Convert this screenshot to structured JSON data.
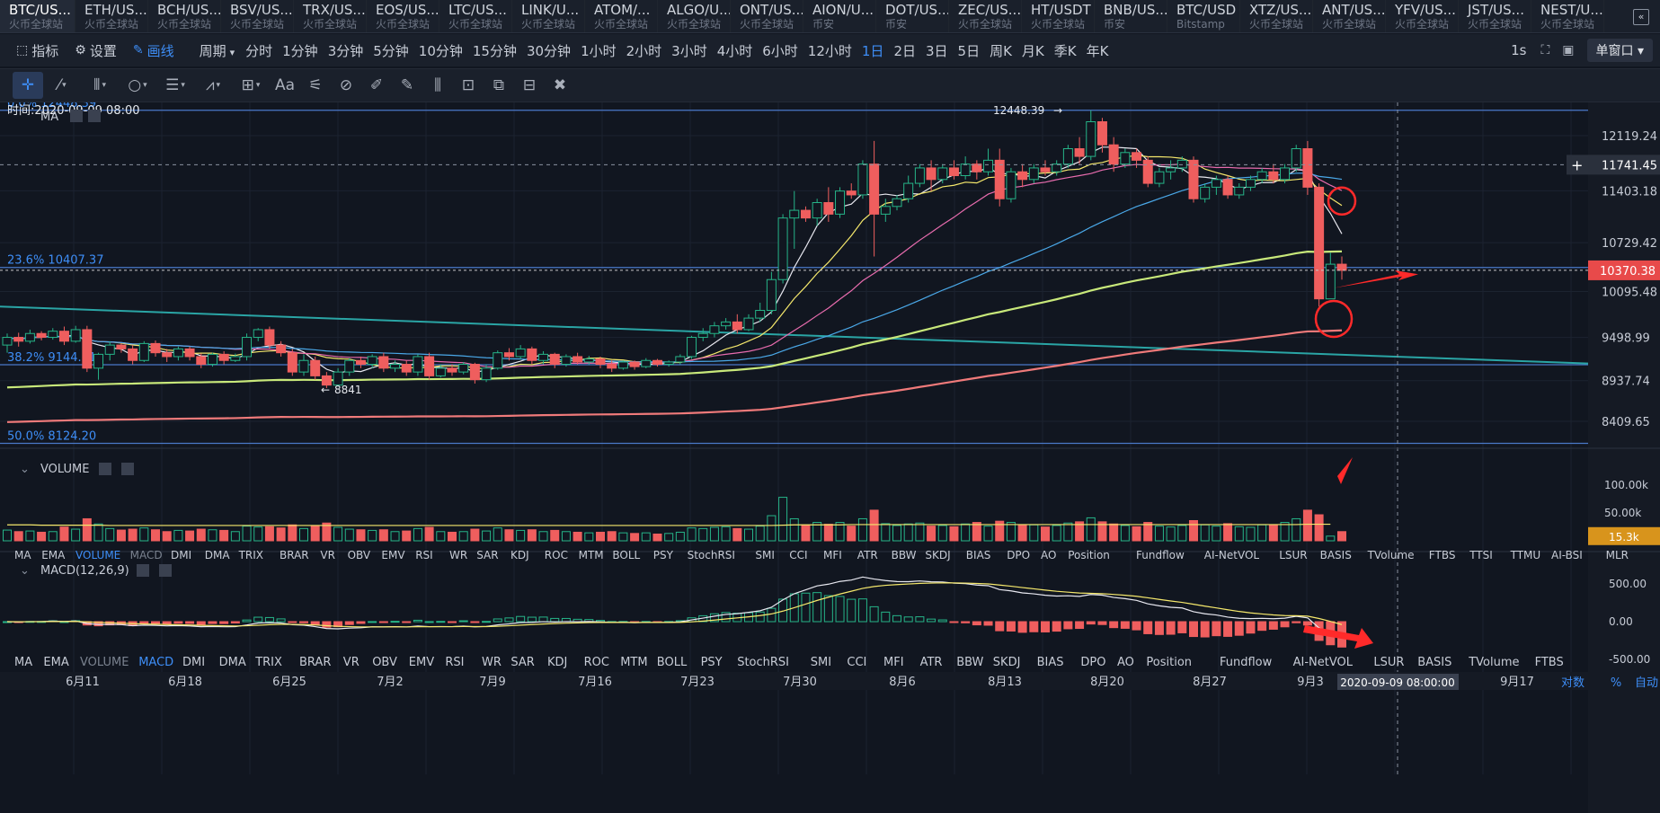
{
  "tabs": [
    {
      "sym": "BTC/US...",
      "ex": "火币全球站",
      "active": true
    },
    {
      "sym": "ETH/US...",
      "ex": "火币全球站"
    },
    {
      "sym": "BCH/US...",
      "ex": "火币全球站"
    },
    {
      "sym": "BSV/US...",
      "ex": "火币全球站"
    },
    {
      "sym": "TRX/US...",
      "ex": "火币全球站"
    },
    {
      "sym": "EOS/US...",
      "ex": "火币全球站"
    },
    {
      "sym": "LTC/US...",
      "ex": "火币全球站"
    },
    {
      "sym": "LINK/U...",
      "ex": "火币全球站"
    },
    {
      "sym": "ATOM/...",
      "ex": "火币全球站"
    },
    {
      "sym": "ALGO/U...",
      "ex": "火币全球站"
    },
    {
      "sym": "ONT/US...",
      "ex": "火币全球站"
    },
    {
      "sym": "AION/U...",
      "ex": "币安"
    },
    {
      "sym": "DOT/US...",
      "ex": "币安"
    },
    {
      "sym": "ZEC/US...",
      "ex": "火币全球站"
    },
    {
      "sym": "HT/USDT",
      "ex": "火币全球站"
    },
    {
      "sym": "BNB/US...",
      "ex": "币安"
    },
    {
      "sym": "BTC/USD",
      "ex": "Bitstamp"
    },
    {
      "sym": "XTZ/US...",
      "ex": "火币全球站"
    },
    {
      "sym": "ANT/US...",
      "ex": "火币全球站"
    },
    {
      "sym": "YFV/US...",
      "ex": "火币全球站"
    },
    {
      "sym": "JST/US...",
      "ex": "火币全球站"
    },
    {
      "sym": "NEST/U...",
      "ex": "火币全球站"
    }
  ],
  "tab_scroll": "«",
  "toolbar": {
    "indicators": "指标",
    "settings": "设置",
    "draw": "画线",
    "period": "周期",
    "periods": [
      "分时",
      "1分钟",
      "3分钟",
      "5分钟",
      "10分钟",
      "15分钟",
      "30分钟",
      "1小时",
      "2小时",
      "3小时",
      "4小时",
      "6小时",
      "12小时",
      "1日",
      "2日",
      "3日",
      "5日",
      "周K",
      "月K",
      "季K",
      "年K"
    ],
    "active_period": "1日",
    "refresh": "1s",
    "window_mode": "单窗口"
  },
  "draw_tools": [
    "crosshair",
    "trend-line",
    "parallel-lines",
    "ellipse",
    "horizontal-lines",
    "pattern",
    "rectangle",
    "text",
    "fibonacci",
    "measure",
    "ruler",
    "pencil",
    "gann",
    "lock",
    "copy",
    "hide",
    "delete"
  ],
  "chart_data": {
    "type": "candlestick",
    "time_label": "时间:2020-09-09 08:00",
    "ma_label": "MA",
    "high_label": "12448.39",
    "low_label": "8841",
    "fib_levels": [
      {
        "label": "0.0% 12448.39",
        "price": 12448.39
      },
      {
        "label": "23.6% 10407.37",
        "price": 10407.37
      },
      {
        "label": "38.2% 9144.71",
        "price": 9144.71
      },
      {
        "label": "50.0% 8124.20",
        "price": 8124.2
      }
    ],
    "price_axis": [
      "12119.24",
      "11403.18",
      "10729.42",
      "10095.48",
      "9498.99",
      "8937.74",
      "8409.65"
    ],
    "crosshair_price": "11741.45",
    "last_price": "10370.38",
    "up_color": "#26b488",
    "down_color": "#ef5e5e",
    "candles_note_fields": [
      "open",
      "close",
      "low",
      "high"
    ],
    "candles": [
      [
        9400,
        9500,
        9300,
        9550
      ],
      [
        9500,
        9450,
        9380,
        9560
      ],
      [
        9450,
        9550,
        9420,
        9600
      ],
      [
        9550,
        9500,
        9460,
        9580
      ],
      [
        9500,
        9580,
        9470,
        9620
      ],
      [
        9580,
        9450,
        9400,
        9640
      ],
      [
        9450,
        9600,
        9430,
        9650
      ],
      [
        9600,
        9100,
        9050,
        9650
      ],
      [
        9100,
        9280,
        8950,
        9300
      ],
      [
        9280,
        9400,
        9200,
        9450
      ],
      [
        9400,
        9350,
        9300,
        9420
      ],
      [
        9350,
        9200,
        9150,
        9400
      ],
      [
        9200,
        9420,
        9180,
        9450
      ],
      [
        9420,
        9300,
        9250,
        9460
      ],
      [
        9300,
        9250,
        9180,
        9350
      ],
      [
        9250,
        9350,
        9200,
        9380
      ],
      [
        9350,
        9250,
        9200,
        9380
      ],
      [
        9250,
        9150,
        9100,
        9290
      ],
      [
        9150,
        9280,
        9120,
        9300
      ],
      [
        9280,
        9200,
        9150,
        9320
      ],
      [
        9200,
        9250,
        9180,
        9290
      ],
      [
        9250,
        9500,
        9200,
        9550
      ],
      [
        9500,
        9600,
        9450,
        9620
      ],
      [
        9600,
        9400,
        9350,
        9640
      ],
      [
        9400,
        9300,
        9250,
        9450
      ],
      [
        9300,
        9050,
        9000,
        9350
      ],
      [
        9050,
        9200,
        9000,
        9280
      ],
      [
        9200,
        9000,
        8950,
        9250
      ],
      [
        9000,
        8880,
        8841,
        9050
      ],
      [
        8880,
        9050,
        8860,
        9100
      ],
      [
        9050,
        9200,
        9000,
        9230
      ],
      [
        9200,
        9150,
        9100,
        9250
      ],
      [
        9150,
        9250,
        9100,
        9280
      ],
      [
        9250,
        9100,
        9050,
        9300
      ],
      [
        9100,
        9150,
        9050,
        9200
      ],
      [
        9150,
        9050,
        9000,
        9200
      ],
      [
        9050,
        9250,
        9000,
        9280
      ],
      [
        9250,
        9000,
        8950,
        9300
      ],
      [
        9000,
        9100,
        8980,
        9150
      ],
      [
        9100,
        9050,
        9000,
        9150
      ],
      [
        9050,
        9150,
        9020,
        9180
      ],
      [
        9150,
        8950,
        8900,
        9170
      ],
      [
        8950,
        9100,
        8920,
        9150
      ],
      [
        9100,
        9300,
        9080,
        9330
      ],
      [
        9300,
        9250,
        9200,
        9360
      ],
      [
        9250,
        9350,
        9220,
        9400
      ],
      [
        9350,
        9200,
        9150,
        9380
      ],
      [
        9200,
        9280,
        9150,
        9320
      ],
      [
        9280,
        9150,
        9100,
        9300
      ],
      [
        9150,
        9250,
        9120,
        9280
      ],
      [
        9250,
        9180,
        9150,
        9300
      ],
      [
        9180,
        9220,
        9150,
        9260
      ],
      [
        9220,
        9150,
        9100,
        9250
      ],
      [
        9150,
        9100,
        9050,
        9200
      ],
      [
        9100,
        9180,
        9080,
        9200
      ],
      [
        9180,
        9120,
        9080,
        9200
      ],
      [
        9120,
        9200,
        9100,
        9230
      ],
      [
        9200,
        9150,
        9120,
        9220
      ],
      [
        9150,
        9180,
        9120,
        9200
      ],
      [
        9180,
        9250,
        9150,
        9280
      ],
      [
        9250,
        9500,
        9220,
        9520
      ],
      [
        9500,
        9550,
        9450,
        9620
      ],
      [
        9550,
        9650,
        9500,
        9700
      ],
      [
        9650,
        9700,
        9600,
        9750
      ],
      [
        9700,
        9600,
        9550,
        9800
      ],
      [
        9600,
        9750,
        9580,
        9800
      ],
      [
        9750,
        9850,
        9700,
        9950
      ],
      [
        9850,
        10250,
        9800,
        10350
      ],
      [
        10250,
        11050,
        10200,
        11100
      ],
      [
        11050,
        11150,
        10650,
        11400
      ],
      [
        11150,
        11050,
        11000,
        11200
      ],
      [
        11050,
        11250,
        10950,
        11300
      ],
      [
        11250,
        11100,
        11000,
        11450
      ],
      [
        11100,
        11400,
        11050,
        11450
      ],
      [
        11400,
        11350,
        11300,
        11500
      ],
      [
        11350,
        11750,
        11300,
        11800
      ],
      [
        11750,
        11100,
        10550,
        12050
      ],
      [
        11100,
        11200,
        11000,
        11300
      ],
      [
        11200,
        11300,
        11150,
        11350
      ],
      [
        11300,
        11500,
        11250,
        11600
      ],
      [
        11500,
        11700,
        11450,
        11750
      ],
      [
        11700,
        11550,
        11400,
        11800
      ],
      [
        11550,
        11700,
        11500,
        11750
      ],
      [
        11700,
        11600,
        11550,
        11800
      ],
      [
        11600,
        11750,
        11550,
        11850
      ],
      [
        11750,
        11650,
        11550,
        11800
      ],
      [
        11650,
        11800,
        11600,
        11950
      ],
      [
        11800,
        11300,
        11200,
        11950
      ],
      [
        11300,
        11650,
        11250,
        11700
      ],
      [
        11650,
        11550,
        11450,
        11750
      ],
      [
        11550,
        11700,
        11500,
        11750
      ],
      [
        11700,
        11650,
        11600,
        11800
      ],
      [
        11650,
        11750,
        11600,
        11800
      ],
      [
        11750,
        11950,
        11700,
        12000
      ],
      [
        11950,
        11850,
        11750,
        12100
      ],
      [
        11850,
        12300,
        11800,
        12448
      ],
      [
        12300,
        12000,
        11900,
        12350
      ],
      [
        12000,
        11750,
        11650,
        12100
      ],
      [
        11750,
        11900,
        11700,
        11950
      ],
      [
        11900,
        11800,
        11700,
        11950
      ],
      [
        11800,
        11500,
        11450,
        11850
      ],
      [
        11500,
        11650,
        11450,
        11700
      ],
      [
        11650,
        11700,
        11550,
        11800
      ],
      [
        11700,
        11800,
        11650,
        11850
      ],
      [
        11800,
        11300,
        11250,
        11850
      ],
      [
        11300,
        11450,
        11250,
        11500
      ],
      [
        11450,
        11550,
        11350,
        11600
      ],
      [
        11550,
        11350,
        11300,
        11600
      ],
      [
        11350,
        11450,
        11300,
        11500
      ],
      [
        11450,
        11550,
        11400,
        11600
      ],
      [
        11550,
        11650,
        11500,
        11700
      ],
      [
        11650,
        11550,
        11500,
        11750
      ],
      [
        11550,
        11700,
        11500,
        11750
      ],
      [
        11700,
        11950,
        11650,
        12000
      ],
      [
        11950,
        11450,
        11350,
        12050
      ],
      [
        11450,
        10000,
        9900,
        11500
      ],
      [
        10000,
        10450,
        10000,
        10600
      ],
      [
        10450,
        10370,
        10250,
        10550
      ]
    ],
    "volumes": [
      35,
      30,
      32,
      28,
      30,
      45,
      38,
      72,
      55,
      40,
      35,
      38,
      42,
      36,
      30,
      34,
      32,
      38,
      36,
      34,
      30,
      48,
      45,
      46,
      42,
      52,
      40,
      48,
      58,
      44,
      38,
      36,
      34,
      36,
      30,
      32,
      40,
      44,
      30,
      28,
      30,
      38,
      32,
      42,
      36,
      34,
      36,
      30,
      34,
      30,
      28,
      26,
      28,
      30,
      26,
      24,
      26,
      22,
      24,
      28,
      42,
      40,
      44,
      46,
      40,
      38,
      48,
      82,
      142,
      72,
      52,
      60,
      54,
      60,
      48,
      72,
      100,
      56,
      50,
      55,
      58,
      48,
      50,
      46,
      55,
      60,
      48,
      64,
      60,
      50,
      52,
      45,
      50,
      58,
      62,
      75,
      62,
      55,
      50,
      46,
      60,
      48,
      45,
      50,
      66,
      52,
      48,
      56,
      46,
      44,
      52,
      50,
      60,
      72,
      100,
      85,
      15.3
    ],
    "volume_ma": [
      52,
      52,
      52,
      51,
      51,
      51,
      51,
      51,
      51,
      50,
      50,
      50,
      50,
      50,
      50,
      50,
      50,
      50,
      50,
      50,
      50,
      50,
      50,
      50,
      50,
      50,
      50,
      50,
      50,
      50,
      50,
      50,
      50,
      50,
      50,
      50,
      50,
      50,
      50,
      50,
      50,
      50,
      50,
      50,
      50,
      50,
      50,
      50,
      50,
      50,
      50,
      50,
      50,
      50,
      50,
      50,
      50,
      50,
      50,
      50,
      50,
      50,
      50,
      50,
      50,
      50,
      50,
      50,
      51,
      52,
      52,
      52,
      52,
      52,
      53,
      53,
      53,
      53,
      53,
      53,
      53,
      53,
      53,
      53,
      53,
      53,
      53,
      53,
      53,
      53,
      53,
      53,
      53,
      53,
      53,
      53,
      53,
      53,
      53,
      53,
      53,
      53,
      53,
      53,
      53,
      53,
      53,
      53,
      53,
      53,
      53,
      53,
      53,
      53,
      54,
      54,
      54
    ],
    "volume_label": "VOLUME",
    "volume_axis": [
      "100.00k",
      "50.00k",
      "0"
    ],
    "volume_last": "15.3k",
    "macd_label": "MACD(12,26,9)",
    "macd_axis": [
      "500.00",
      "0.00",
      "-500.00"
    ],
    "indicator_tabs": [
      "MA",
      "EMA",
      "VOLUME",
      "MACD",
      "DMI",
      "DMA",
      "TRIX",
      "BRAR",
      "VR",
      "OBV",
      "EMV",
      "RSI",
      "WR",
      "SAR",
      "KDJ",
      "ROC",
      "MTM",
      "BOLL",
      "PSY",
      "StochRSI",
      "SMI",
      "CCI",
      "MFI",
      "ATR",
      "BBW",
      "SKDJ",
      "BIAS",
      "DPO",
      "AO",
      "Position",
      "Fundflow",
      "AI-NetVOL",
      "LSUR",
      "BASIS",
      "TVolume",
      "FTBS",
      "TTSI",
      "TTMU",
      "AI-BSI",
      "MLR"
    ],
    "indicator_tabs2": [
      "MA",
      "EMA",
      "VOLUME",
      "MACD",
      "DMI",
      "DMA",
      "TRIX",
      "BRAR",
      "VR",
      "OBV",
      "EMV",
      "RSI",
      "WR",
      "SAR",
      "KDJ",
      "ROC",
      "MTM",
      "BOLL",
      "PSY",
      "StochRSI",
      "SMI",
      "CCI",
      "MFI",
      "ATR",
      "BBW",
      "SKDJ",
      "BIAS",
      "DPO",
      "AO",
      "Position",
      "Fundflow",
      "AI-NetVOL",
      "LSUR",
      "BASIS",
      "TVolume",
      "FTBS"
    ],
    "date_axis": [
      "6月11",
      "6月18",
      "6月25",
      "7月2",
      "7月9",
      "7月16",
      "7月23",
      "7月30",
      "8月6",
      "8月13",
      "8月20",
      "8月27",
      "9月3",
      "9月17"
    ],
    "date_cursor": "2020-09-09 08:00:00",
    "footer_right": [
      "对数",
      "%",
      "自动"
    ]
  }
}
